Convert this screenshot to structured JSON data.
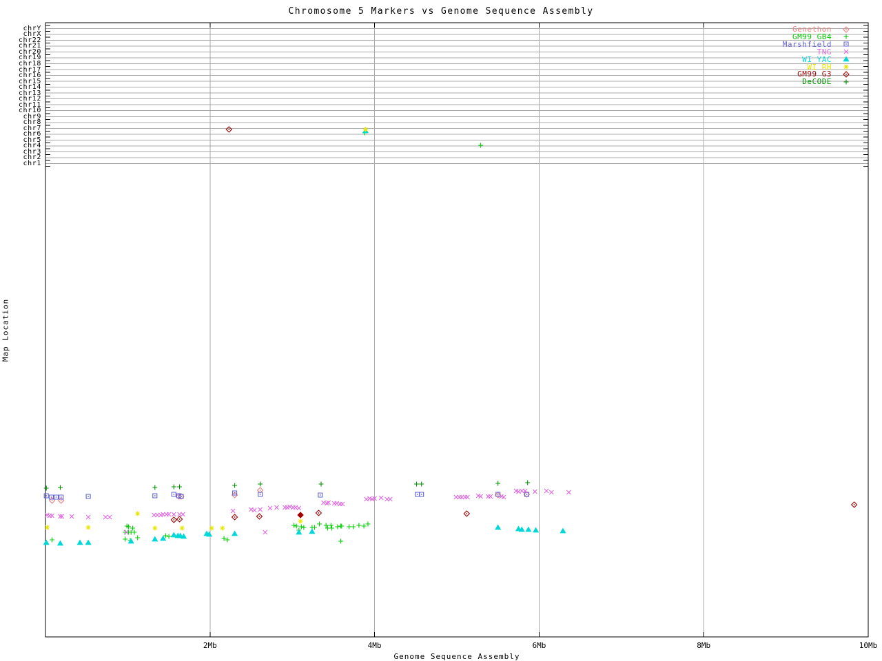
{
  "title": "Chromosome 5 Markers vs Genome Sequence Assembly",
  "chart_data": {
    "type": "scatter",
    "title": "Chromosome 5 Markers vs Genome Sequence Assembly",
    "x_axis": {
      "label": "Genome Sequence Assembly",
      "units": "Mb",
      "range_mb": [
        0,
        10
      ],
      "ticks": [
        {
          "mb": 2,
          "label": "2Mb"
        },
        {
          "mb": 4,
          "label": "4Mb"
        },
        {
          "mb": 6,
          "label": "6Mb"
        },
        {
          "mb": 8,
          "label": "8Mb"
        },
        {
          "mb": 10,
          "label": "10Mb"
        }
      ],
      "grid_mb": [
        2,
        4,
        6,
        8
      ]
    },
    "y_axis": {
      "label": "Map Location",
      "note": "top band rows are chromosomes for discordant markers; lower cluster is the chr5 map region (no numeric scale printed); point y values below are screen-pixel map locations",
      "bands": [
        "chrY",
        "chrX",
        "chr22",
        "chr21",
        "chr20",
        "chr19",
        "chr18",
        "chr17",
        "chr16",
        "chr15",
        "chr14",
        "chr13",
        "chr12",
        "chr11",
        "chr10",
        "chr9",
        "chr8",
        "chr7",
        "chr6",
        "chr5",
        "chr4",
        "chr3",
        "chr2",
        "chr1"
      ]
    },
    "legend_position": "top-right-inside",
    "grid": true,
    "series": [
      {
        "name": "Genethon",
        "color": "#f08080",
        "symbol": "diamond-dot",
        "points": [
          [
            0.08,
            727
          ],
          [
            0.19,
            727
          ],
          [
            1.62,
            721
          ],
          [
            1.65,
            721
          ],
          [
            2.3,
            719
          ],
          [
            2.61,
            712
          ],
          [
            5.5,
            719
          ],
          [
            5.85,
            718
          ]
        ]
      },
      {
        "name": "GM99 GB4",
        "color": "#00cc00",
        "symbol": "plus",
        "points": [
          [
            0.08,
            784
          ],
          [
            0.97,
            773
          ],
          [
            0.97,
            783
          ],
          [
            0.99,
            764
          ],
          [
            1.01,
            765
          ],
          [
            1.01,
            773
          ],
          [
            1.03,
            785
          ],
          [
            1.04,
            773
          ],
          [
            1.06,
            767
          ],
          [
            1.08,
            773
          ],
          [
            1.12,
            781
          ],
          [
            1.46,
            778
          ],
          [
            1.5,
            779
          ],
          [
            2.17,
            782
          ],
          [
            2.21,
            784
          ],
          [
            3.02,
            763
          ],
          [
            3.05,
            764
          ],
          [
            3.08,
            770
          ],
          [
            3.11,
            765
          ],
          [
            3.14,
            766
          ],
          [
            3.24,
            766
          ],
          [
            3.27,
            766
          ],
          [
            3.33,
            761
          ],
          [
            3.41,
            763
          ],
          [
            3.43,
            767
          ],
          [
            3.47,
            763
          ],
          [
            3.48,
            767
          ],
          [
            3.55,
            765
          ],
          [
            3.59,
            764
          ],
          [
            3.6,
            764
          ],
          [
            3.59,
            786
          ],
          [
            3.69,
            765
          ],
          [
            3.74,
            765
          ],
          [
            3.81,
            763
          ],
          [
            3.87,
            764
          ],
          [
            3.92,
            761
          ],
          [
            3.88,
            193
          ],
          [
            5.29,
            211
          ]
        ]
      },
      {
        "name": "Marshfield",
        "color": "#6060d0",
        "symbol": "square-dot",
        "points": [
          [
            0.01,
            720
          ],
          [
            0.07,
            722
          ],
          [
            0.13,
            722
          ],
          [
            0.19,
            722
          ],
          [
            0.52,
            721
          ],
          [
            1.33,
            720
          ],
          [
            1.56,
            718
          ],
          [
            1.62,
            720
          ],
          [
            1.65,
            721
          ],
          [
            2.3,
            716
          ],
          [
            2.61,
            718
          ],
          [
            3.34,
            719
          ],
          [
            4.52,
            718
          ],
          [
            4.57,
            718
          ],
          [
            5.5,
            718
          ],
          [
            5.85,
            718
          ]
        ]
      },
      {
        "name": "TNG",
        "color": "#e066e0",
        "symbol": "cross",
        "points": [
          [
            0.02,
            748
          ],
          [
            0.05,
            749
          ],
          [
            0.08,
            749
          ],
          [
            0.18,
            750
          ],
          [
            0.2,
            750
          ],
          [
            0.32,
            750
          ],
          [
            0.52,
            751
          ],
          [
            0.73,
            751
          ],
          [
            0.78,
            751
          ],
          [
            0.98,
            773
          ],
          [
            1.32,
            748
          ],
          [
            1.36,
            748
          ],
          [
            1.4,
            748
          ],
          [
            1.43,
            747
          ],
          [
            1.47,
            747
          ],
          [
            1.5,
            747
          ],
          [
            1.56,
            747
          ],
          [
            1.63,
            747
          ],
          [
            1.67,
            747
          ],
          [
            2.28,
            742
          ],
          [
            2.5,
            740
          ],
          [
            2.54,
            741
          ],
          [
            2.61,
            740
          ],
          [
            2.67,
            773
          ],
          [
            2.73,
            738
          ],
          [
            2.81,
            737
          ],
          [
            2.91,
            737
          ],
          [
            2.94,
            737
          ],
          [
            2.97,
            736
          ],
          [
            3.01,
            737
          ],
          [
            3.04,
            737
          ],
          [
            3.08,
            738
          ],
          [
            3.38,
            730
          ],
          [
            3.42,
            731
          ],
          [
            3.44,
            730
          ],
          [
            3.51,
            731
          ],
          [
            3.54,
            731
          ],
          [
            3.58,
            732
          ],
          [
            3.61,
            732
          ],
          [
            3.9,
            725
          ],
          [
            3.94,
            724
          ],
          [
            3.97,
            725
          ],
          [
            4.0,
            724
          ],
          [
            4.08,
            723
          ],
          [
            4.15,
            725
          ],
          [
            4.19,
            725
          ],
          [
            4.99,
            722
          ],
          [
            5.03,
            722
          ],
          [
            5.06,
            722
          ],
          [
            5.1,
            722
          ],
          [
            5.13,
            722
          ],
          [
            5.26,
            720
          ],
          [
            5.29,
            721
          ],
          [
            5.38,
            721
          ],
          [
            5.41,
            721
          ],
          [
            5.54,
            721
          ],
          [
            5.57,
            722
          ],
          [
            5.72,
            713
          ],
          [
            5.75,
            714
          ],
          [
            5.79,
            713
          ],
          [
            5.83,
            713
          ],
          [
            5.95,
            714
          ],
          [
            6.09,
            713
          ],
          [
            6.15,
            715
          ],
          [
            6.36,
            715
          ]
        ]
      },
      {
        "name": "WI YAC",
        "color": "#00d8d8",
        "symbol": "triangle",
        "points": [
          [
            0.01,
            788
          ],
          [
            0.18,
            789
          ],
          [
            0.42,
            788
          ],
          [
            0.52,
            788
          ],
          [
            1.04,
            786
          ],
          [
            1.33,
            783
          ],
          [
            1.43,
            782
          ],
          [
            1.56,
            777
          ],
          [
            1.61,
            778
          ],
          [
            1.64,
            778
          ],
          [
            1.68,
            779
          ],
          [
            1.96,
            775
          ],
          [
            1.99,
            776
          ],
          [
            2.3,
            775
          ],
          [
            3.08,
            773
          ],
          [
            3.24,
            772
          ],
          [
            3.89,
            190
          ],
          [
            5.5,
            766
          ],
          [
            5.75,
            768
          ],
          [
            5.79,
            769
          ],
          [
            5.87,
            769
          ],
          [
            5.96,
            770
          ],
          [
            6.29,
            771
          ]
        ]
      },
      {
        "name": "WI RH",
        "color": "#e6e600",
        "symbol": "star",
        "points": [
          [
            0.02,
            766
          ],
          [
            0.52,
            766
          ],
          [
            1.12,
            746
          ],
          [
            1.33,
            767
          ],
          [
            1.66,
            767
          ],
          [
            2.02,
            767
          ],
          [
            2.15,
            767
          ],
          [
            3.1,
            757
          ],
          [
            3.89,
            188
          ]
        ]
      },
      {
        "name": "GM99 G3",
        "color": "#a00000",
        "symbol": "diamond-dot",
        "points": [
          [
            1.56,
            755
          ],
          [
            1.63,
            754
          ],
          [
            2.23,
            188
          ],
          [
            2.3,
            751
          ],
          [
            2.6,
            750
          ],
          [
            3.1,
            748,
            "filled"
          ],
          [
            3.32,
            745
          ],
          [
            5.12,
            746
          ],
          [
            9.83,
            733
          ]
        ]
      },
      {
        "name": "DeCODE",
        "color": "#009000",
        "symbol": "plus",
        "points": [
          [
            0.01,
            709
          ],
          [
            0.18,
            708
          ],
          [
            1.33,
            708
          ],
          [
            1.56,
            707
          ],
          [
            1.63,
            707
          ],
          [
            2.3,
            705
          ],
          [
            2.61,
            703
          ],
          [
            3.35,
            703
          ],
          [
            4.51,
            703
          ],
          [
            4.57,
            703
          ],
          [
            5.5,
            702
          ],
          [
            5.86,
            701
          ]
        ]
      }
    ]
  }
}
